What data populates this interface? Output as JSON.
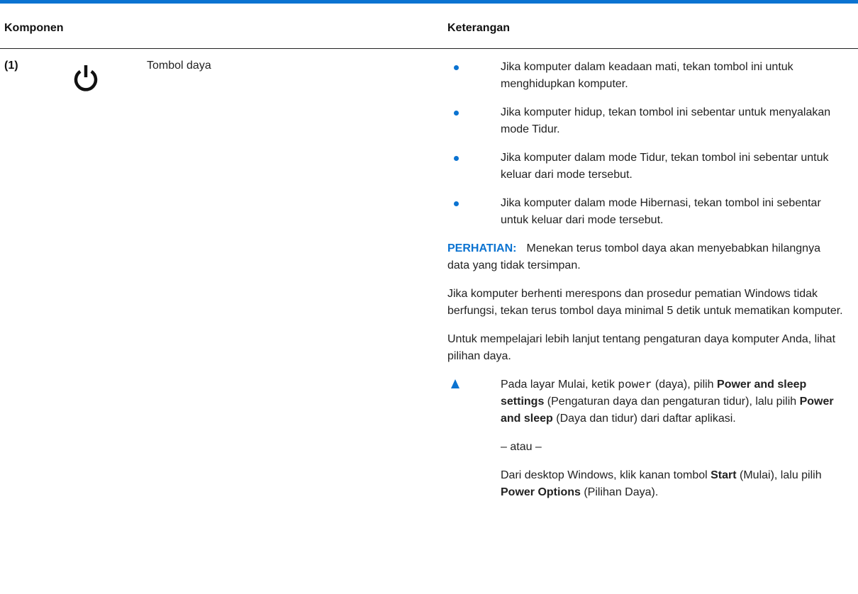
{
  "colors": {
    "accent": "#0b73d1",
    "text": "#222222"
  },
  "header": {
    "component": "Komponen",
    "description": "Keterangan"
  },
  "row": {
    "number": "(1)",
    "icon": "power-icon",
    "name": "Tombol daya",
    "bullets": [
      "Jika komputer dalam keadaan mati, tekan tombol ini untuk menghidupkan komputer.",
      "Jika komputer hidup, tekan tombol ini sebentar untuk menyalakan mode Tidur.",
      "Jika komputer dalam mode Tidur, tekan tombol ini sebentar untuk keluar dari mode tersebut.",
      "Jika komputer dalam mode Hibernasi, tekan tombol ini sebentar untuk keluar dari mode tersebut."
    ],
    "caution_label": "PERHATIAN:",
    "caution_text": "Menekan terus tombol daya akan menyebabkan hilangnya data yang tidak tersimpan.",
    "para_unresponsive": "Jika komputer berhenti merespons dan prosedur pematian Windows tidak berfungsi, tekan terus tombol daya minimal 5 detik untuk mematikan komputer.",
    "para_learn": "Untuk mempelajari lebih lanjut tentang pengaturan daya komputer Anda, lihat pilihan daya.",
    "step": {
      "t1": "Pada layar Mulai, ketik ",
      "code": "power",
      "t2": " (daya), pilih ",
      "b1": "Power and sleep settings",
      "t3": " (Pengaturan daya dan pengaturan tidur), lalu pilih ",
      "b2": "Power and sleep",
      "t4": " (Daya dan tidur) dari daftar aplikasi."
    },
    "or": "– atau –",
    "alt": {
      "t1": "Dari desktop Windows, klik kanan tombol ",
      "b1": "Start",
      "t2": " (Mulai), lalu pilih ",
      "b2": "Power Options",
      "t3": " (Pilihan Daya)."
    }
  }
}
